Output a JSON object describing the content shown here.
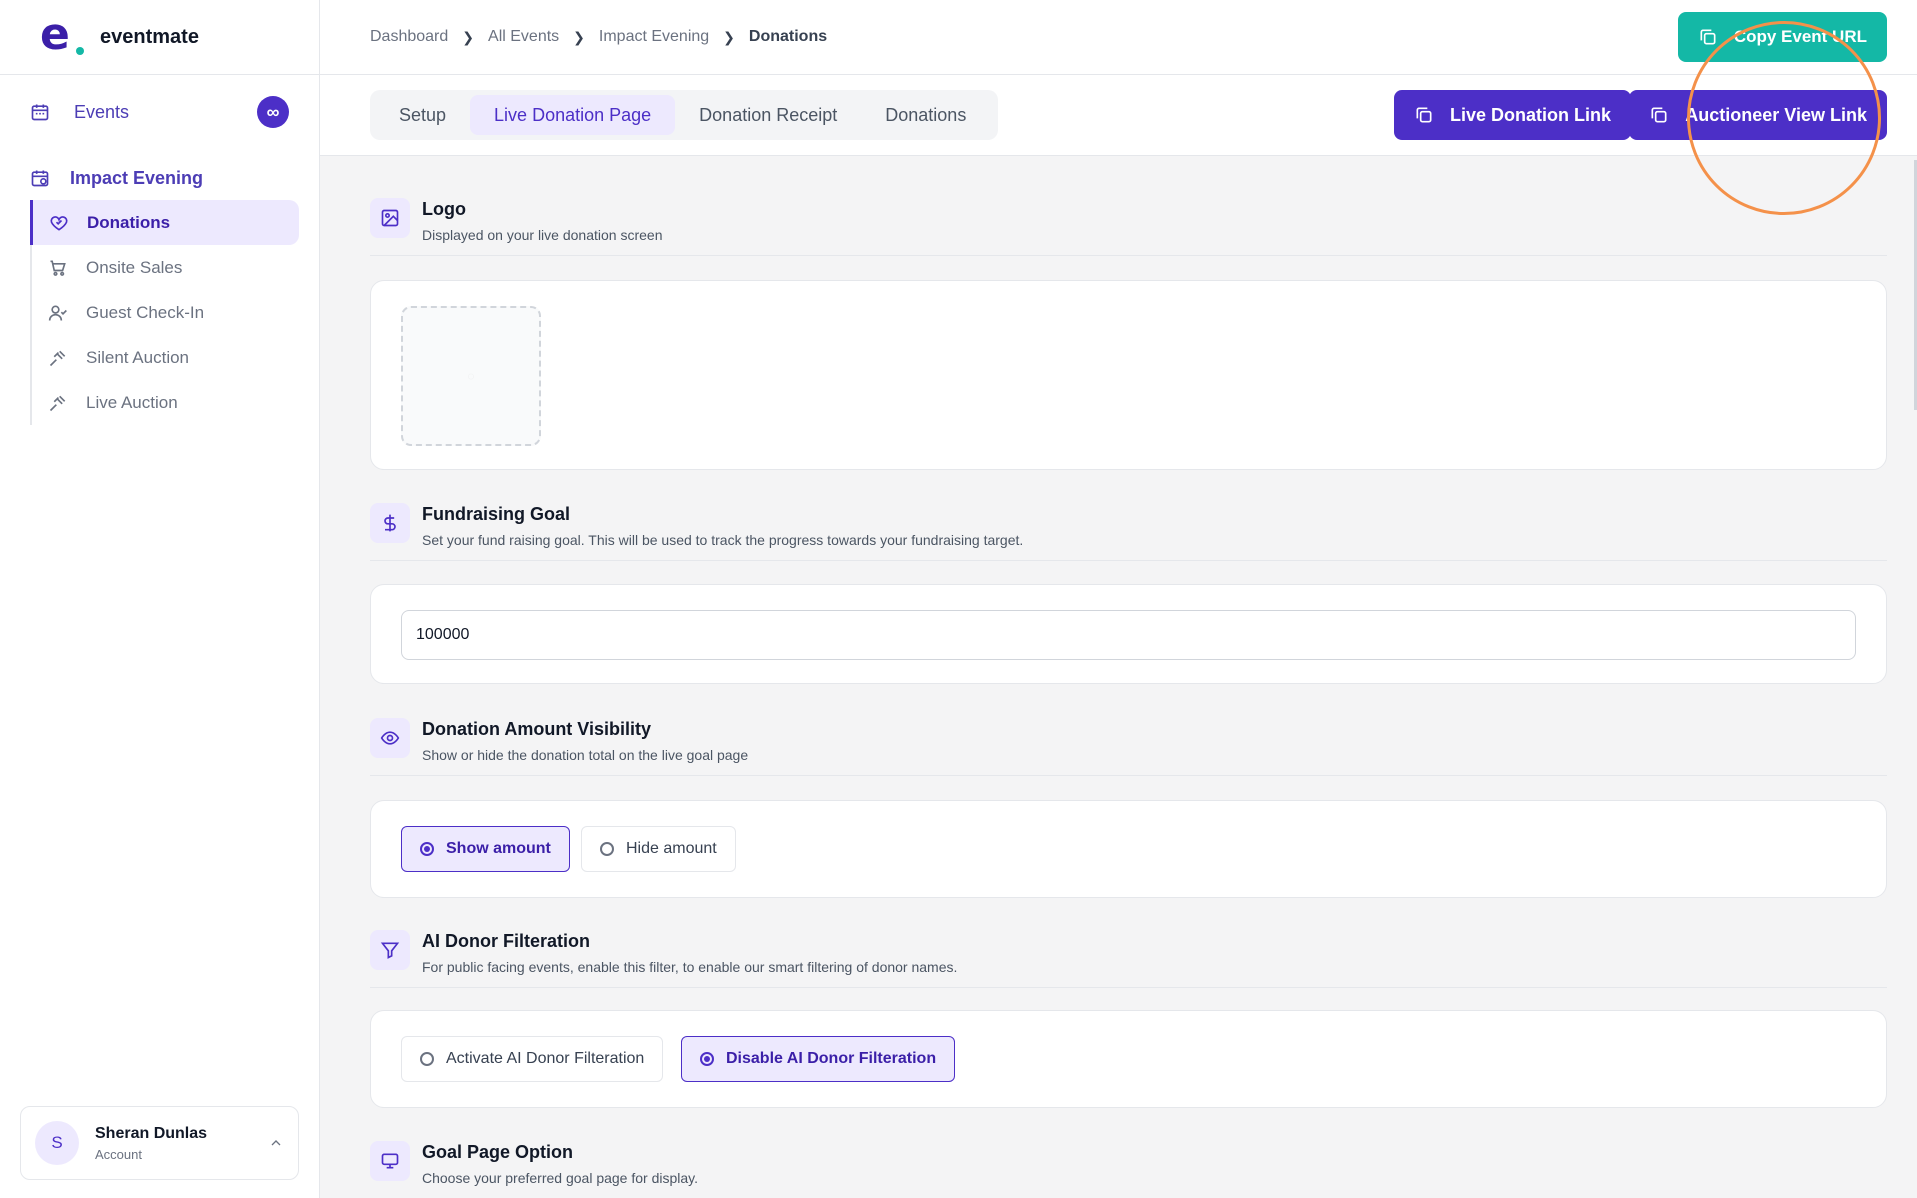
{
  "brand": {
    "name": "eventmate",
    "logo_letter": "e"
  },
  "sidebar": {
    "events_label": "Events",
    "events_badge": "∞",
    "group_title": "Impact Evening",
    "items": [
      {
        "label": "Donations",
        "icon": "heart-handshake-icon",
        "active": true
      },
      {
        "label": "Onsite Sales",
        "icon": "cart-icon",
        "active": false
      },
      {
        "label": "Guest Check-In",
        "icon": "user-check-icon",
        "active": false
      },
      {
        "label": "Silent Auction",
        "icon": "gavel-icon",
        "active": false
      },
      {
        "label": "Live Auction",
        "icon": "gavel-icon",
        "active": false
      }
    ],
    "account": {
      "initial": "S",
      "name": "Sheran Dunlas",
      "sub": "Account"
    }
  },
  "breadcrumb": [
    "Dashboard",
    "All Events",
    "Impact Evening",
    "Donations"
  ],
  "header": {
    "copy_event_url": "Copy Event URL"
  },
  "tabs": [
    "Setup",
    "Live Donation Page",
    "Donation Receipt",
    "Donations"
  ],
  "active_tab": "Live Donation Page",
  "actions": {
    "live_donation_link": "Live Donation Link",
    "auctioneer_view_link": "Auctioneer View Link"
  },
  "sections": {
    "logo": {
      "title": "Logo",
      "desc": "Displayed on your live donation screen"
    },
    "goal": {
      "title": "Fundraising Goal",
      "desc": "Set your fund raising goal. This will be used to track the progress towards your fundraising target.",
      "value": "100000"
    },
    "visibility": {
      "title": "Donation Amount Visibility",
      "desc": "Show or hide the donation total on the live goal page",
      "options": [
        "Show amount",
        "Hide amount"
      ],
      "selected": "Show amount"
    },
    "ai_filter": {
      "title": "AI Donor Filteration",
      "desc": "For public facing events, enable this filter, to enable our smart filtering of donor names.",
      "options": [
        "Activate AI Donor Filteration",
        "Disable AI Donor Filteration"
      ],
      "selected": "Disable AI Donor Filteration"
    },
    "goal_page": {
      "title": "Goal Page Option",
      "desc": "Choose your preferred goal page for display."
    }
  },
  "colors": {
    "primary": "#4c2fc7",
    "teal": "#14b8a6",
    "highlight": "#f4914a",
    "active_bg": "#ede9fe"
  }
}
